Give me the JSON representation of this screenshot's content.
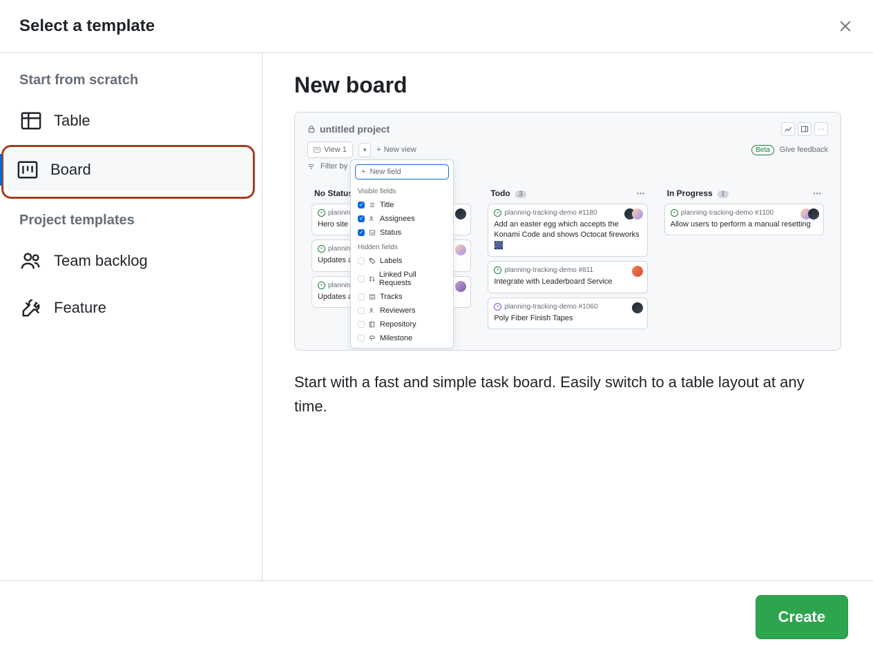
{
  "modal": {
    "title": "Select a template",
    "close_label": "Close"
  },
  "sidebar": {
    "scratch_heading": "Start from scratch",
    "templates_heading": "Project templates",
    "items": {
      "table": "Table",
      "board": "Board",
      "team_backlog": "Team backlog",
      "feature": "Feature"
    }
  },
  "content": {
    "title": "New board",
    "description": "Start with a fast and simple task board. Easily switch to a table layout at any time."
  },
  "preview": {
    "project_name": "untitled project",
    "view_tab": "View 1",
    "new_view": "New view",
    "beta": "Beta",
    "give_feedback": "Give feedback",
    "filter_by": "Filter by",
    "new_field": "New field",
    "visible_fields": "Visible fields",
    "hidden_fields": "Hidden fields",
    "fields": {
      "title": "Title",
      "assignees": "Assignees",
      "status": "Status",
      "labels": "Labels",
      "linked_prs": "Linked Pull Requests",
      "tracks": "Tracks",
      "reviewers": "Reviewers",
      "repository": "Repository",
      "milestone": "Milestone"
    },
    "columns": {
      "no_status": {
        "label": "No Status"
      },
      "todo": {
        "label": "Todo",
        "count": "3"
      },
      "in_progress": {
        "label": "In Progress",
        "count": "1"
      }
    },
    "cards": {
      "ns1": {
        "ref": "planning",
        "title": "Hero site"
      },
      "ns2": {
        "ref": "planning",
        "title": "Updates a"
      },
      "ns3": {
        "ref": "planning",
        "title": "Updates a"
      },
      "t1": {
        "ref": "planning-tracking-demo #1180",
        "title": "Add an easter egg which accepts the Konami Code and shows Octocat fireworks 🎆"
      },
      "t2": {
        "ref": "planning-tracking-demo #811",
        "title": "Integrate with Leaderboard Service"
      },
      "t3": {
        "ref": "planning-tracking-demo #1060",
        "title": "Poly Fiber Finish Tapes"
      },
      "p1": {
        "ref": "planning-tracking-demo #1100",
        "title": "Allow users to perform a manual resetting"
      }
    }
  },
  "footer": {
    "create": "Create"
  }
}
